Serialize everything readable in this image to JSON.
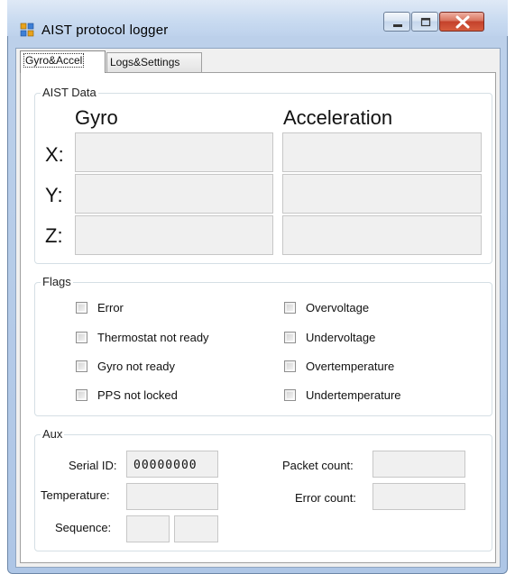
{
  "window": {
    "title": "AIST protocol logger",
    "icons": {
      "app": "app-icon",
      "minimize": "minimize-icon",
      "maximize": "maximize-icon",
      "close": "close-icon"
    }
  },
  "tabs": [
    {
      "label": "Gyro&Accel",
      "selected": true
    },
    {
      "label": "Logs&Settings",
      "selected": false
    }
  ],
  "aist_data": {
    "group_label": "AIST Data",
    "gyro_header": "Gyro",
    "accel_header": "Acceleration",
    "axes": [
      "X:",
      "Y:",
      "Z:"
    ],
    "gyro_values": [
      "",
      "",
      ""
    ],
    "accel_values": [
      "",
      "",
      ""
    ]
  },
  "flags": {
    "group_label": "Flags",
    "left": [
      {
        "label": "Error",
        "checked": false
      },
      {
        "label": "Thermostat not ready",
        "checked": false
      },
      {
        "label": "Gyro not ready",
        "checked": false
      },
      {
        "label": "PPS not locked",
        "checked": false
      }
    ],
    "right": [
      {
        "label": "Overvoltage",
        "checked": false
      },
      {
        "label": "Undervoltage",
        "checked": false
      },
      {
        "label": "Overtemperature",
        "checked": false
      },
      {
        "label": "Undertemperature",
        "checked": false
      }
    ]
  },
  "aux": {
    "group_label": "Aux",
    "serial_label": "Serial ID:",
    "serial_value": "00000000",
    "temperature_label": "Temperature:",
    "temperature_value": "",
    "sequence_label": "Sequence:",
    "sequence_values": [
      "",
      ""
    ],
    "packet_count_label": "Packet count:",
    "packet_count_value": "",
    "error_count_label": "Error count:",
    "error_count_value": ""
  }
}
